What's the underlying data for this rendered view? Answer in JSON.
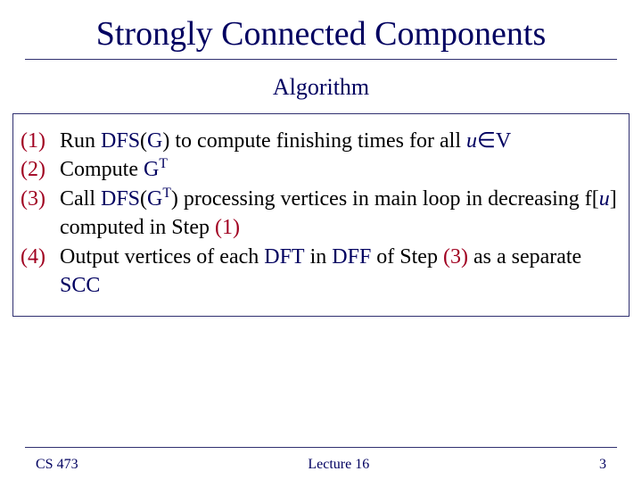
{
  "title": "Strongly Connected Components",
  "subtitle": "Algorithm",
  "steps": {
    "n1": "(1)",
    "n2": "(2)",
    "n3": "(3)",
    "n4": "(4)",
    "s1_a": "Run ",
    "s1_dfs": "DFS",
    "s1_b": "(",
    "s1_g": "G",
    "s1_c": ") to compute finishing times for all ",
    "s1_u": "u",
    "s1_in": "∈",
    "s1_v": "V",
    "s2_a": "Compute ",
    "s2_g": "G",
    "s2_t": "T",
    "s3_a": "Call ",
    "s3_dfs": "DFS",
    "s3_b": "(",
    "s3_g": "G",
    "s3_t": "T",
    "s3_c": ") processing vertices in main loop in decreasing f[",
    "s3_u": "u",
    "s3_d": "] computed in Step ",
    "s3_step": "(1)",
    "s4_a": "Output vertices of each ",
    "s4_dft": "DFT",
    "s4_b": " in ",
    "s4_dff": "DFF",
    "s4_c": " of Step ",
    "s4_step": "(3)",
    "s4_d": " as a separate ",
    "s4_scc": "SCC"
  },
  "footer": {
    "course": "CS 473",
    "lecture": "Lecture 16",
    "page": "3"
  }
}
